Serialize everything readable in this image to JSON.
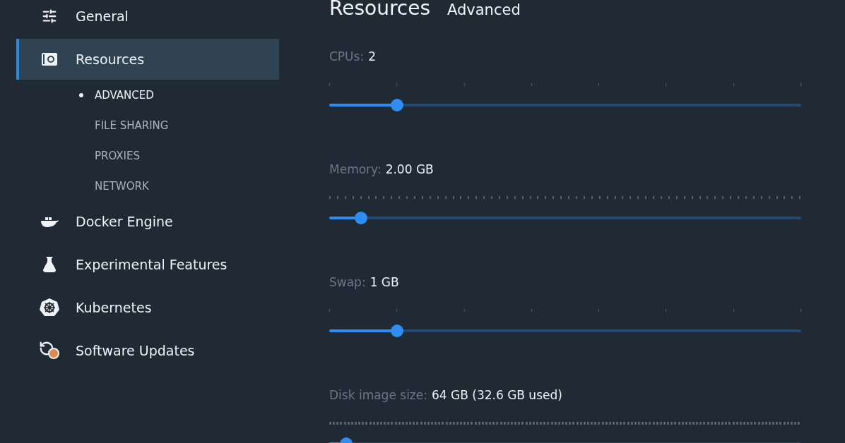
{
  "title": "Resources",
  "subtitle": "Advanced",
  "sidebar": {
    "items": [
      {
        "label": "General",
        "kind": "sliders",
        "selected": false
      },
      {
        "label": "Resources",
        "kind": "resources",
        "selected": true,
        "children": [
          {
            "label": "ADVANCED",
            "selected": true
          },
          {
            "label": "FILE SHARING",
            "selected": false
          },
          {
            "label": "PROXIES",
            "selected": false
          },
          {
            "label": "NETWORK",
            "selected": false
          }
        ]
      },
      {
        "label": "Docker Engine",
        "kind": "whale",
        "selected": false
      },
      {
        "label": "Experimental Features",
        "kind": "flask",
        "selected": false
      },
      {
        "label": "Kubernetes",
        "kind": "helm",
        "selected": false
      },
      {
        "label": "Software Updates",
        "kind": "updates",
        "selected": false
      }
    ]
  },
  "sliders": [
    {
      "label": "CPUs:",
      "value": "2",
      "level": 0.144,
      "kind": "coarse"
    },
    {
      "label": "Memory:",
      "value": "2.00 GB",
      "level": 0.067,
      "kind": "fine"
    },
    {
      "label": "Swap:",
      "value": "1 GB",
      "level": 0.144,
      "kind": "coarse"
    },
    {
      "label": "Disk image size:",
      "value": "64 GB (32.6 GB used)",
      "level": 0.036,
      "kind": "dense"
    }
  ]
}
